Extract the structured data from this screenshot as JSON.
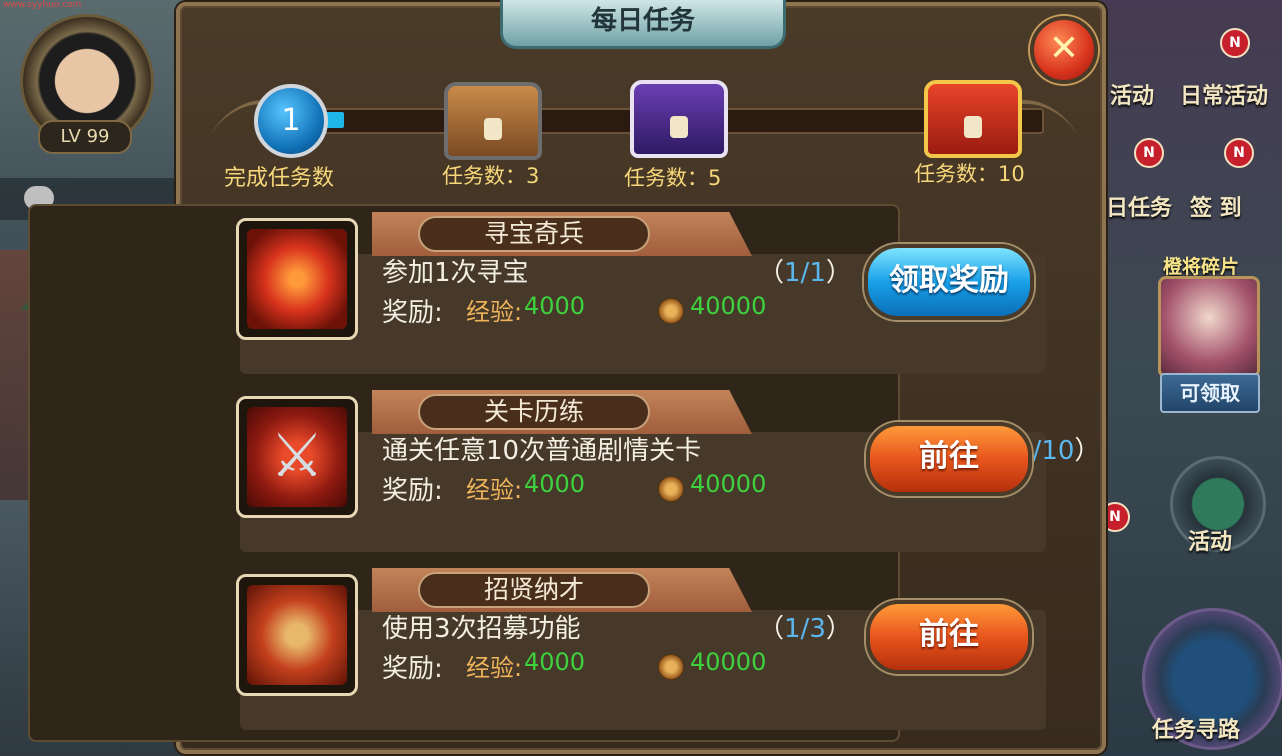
{
  "watermark": "www.syyhuo.com",
  "player": {
    "level": "LV 99"
  },
  "sidebar": {
    "activity_label": "活动",
    "daily_activity_label": "日常活动",
    "daily_task_label": "日任务",
    "sign_in_label": "签 到",
    "shard_title": "橙将碎片",
    "claimable_label": "可领取",
    "activity2_label": "活动",
    "quest_nav_label": "任务寻路",
    "badge_letter": "N"
  },
  "panel": {
    "title": "每日任务",
    "close_symbol": "✕",
    "completed_count": "1",
    "completed_caption": "完成任务数",
    "progress_fraction": 0.03,
    "chests": [
      {
        "label": "任务数：3",
        "kind": "bronze-chest-icon"
      },
      {
        "label": "任务数：5",
        "kind": "silver-chest-icon"
      },
      {
        "label": "任务数：10",
        "kind": "gold-chest-icon"
      }
    ]
  },
  "tasks": [
    {
      "name": "寻宝奇兵",
      "description": "参加1次寻宝",
      "progress_open": "（",
      "progress": "1/1",
      "progress_close": "）",
      "reward_label": "奖励:",
      "exp_label": "经验:",
      "exp_value": "4000",
      "coin_value": "40000",
      "button": "领取奖励"
    },
    {
      "name": "关卡历练",
      "description": "通关任意10次普通剧情关卡",
      "progress_open": "（",
      "progress": "2/10",
      "progress_close": "）",
      "reward_label": "奖励:",
      "exp_label": "经验:",
      "exp_value": "4000",
      "coin_value": "40000",
      "button": "前往"
    },
    {
      "name": "招贤纳才",
      "description": "使用3次招募功能",
      "progress_open": "（",
      "progress": "1/3",
      "progress_close": "）",
      "reward_label": "奖励:",
      "exp_label": "经验:",
      "exp_value": "4000",
      "coin_value": "40000",
      "button": "前往"
    }
  ]
}
